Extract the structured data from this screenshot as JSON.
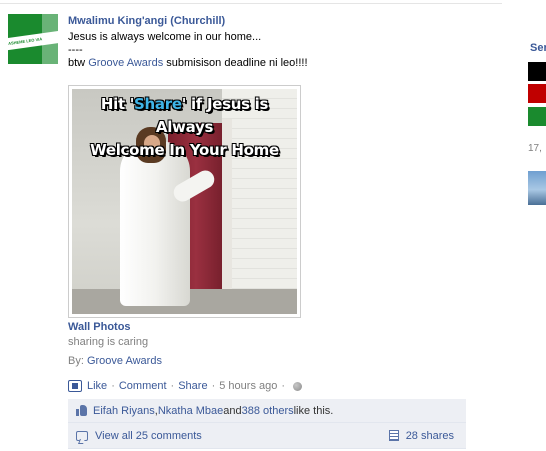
{
  "post": {
    "author": "Mwalimu King'angi (Churchill)",
    "message_line1": "Jesus is always welcome in our home...",
    "message_line2": "----",
    "message_line3_prefix": "btw ",
    "message_line3_link": "Groove Awards",
    "message_line3_suffix": " submisison deadline ni leo!!!!",
    "avatar_banner_text": "ASHEME LEO VIA",
    "photo_caption_line1_pre": "Hit '",
    "photo_caption_line1_highlight": "Share",
    "photo_caption_line1_post": "' if Jesus is Always",
    "photo_caption_line2": "Welcome In Your Home",
    "album_title": "Wall Photos",
    "album_description": "sharing is caring",
    "by_label": "By: ",
    "by_link": "Groove Awards"
  },
  "actions": {
    "like": "Like",
    "comment": "Comment",
    "share": "Share",
    "timestamp": "5 hours ago",
    "separator": "·"
  },
  "ufi": {
    "likers": [
      "Eifah Riyans",
      "Nkatha Mbae"
    ],
    "liker_sep": ", ",
    "and_text": " and ",
    "others_link": "388 others",
    "like_suffix": " like this.",
    "view_comments": "View all 25 comments",
    "shares": "28 shares"
  },
  "right_column": {
    "header_partial": "Ser",
    "count_partial": "17,",
    "swatches": [
      "#000000",
      "#c00000",
      "#1a8a2e"
    ]
  }
}
